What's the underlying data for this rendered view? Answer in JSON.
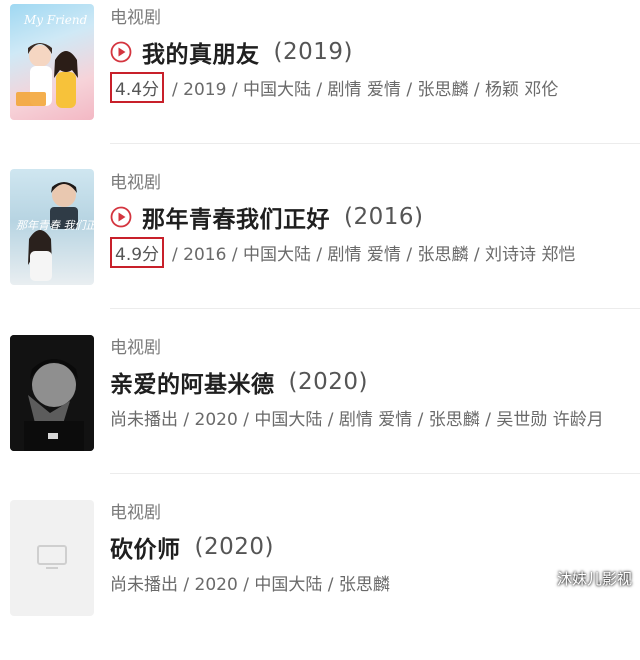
{
  "results": [
    {
      "category": "电视剧",
      "title": "我的真朋友",
      "year": "(2019)",
      "rating": "4.4分",
      "meta": "/ 2019 / 中国大陆 / 剧情 爱情 / 张思麟 / 杨颖 邓伦",
      "poster_text": "My Friend",
      "playable": true
    },
    {
      "category": "电视剧",
      "title": "那年青春我们正好",
      "year": "(2016)",
      "rating": "4.9分",
      "meta": "/ 2016 / 中国大陆 / 剧情 爱情 / 张思麟 / 刘诗诗 郑恺",
      "poster_text": "那年青春 我们正好",
      "playable": true
    },
    {
      "category": "电视剧",
      "title": "亲爱的阿基米德",
      "year": "(2020)",
      "meta": "尚未播出 / 2020 / 中国大陆 / 剧情 爱情 / 张思麟 / 吴世勋 许龄月",
      "playable": false
    },
    {
      "category": "电视剧",
      "title": "砍价师",
      "year": "(2020)",
      "meta": "尚未播出 / 2020 / 中国大陆 / 张思麟",
      "playable": false
    }
  ],
  "colors": {
    "play_icon": "#d4353f",
    "rating_highlight": "#c8202a"
  },
  "icons": {
    "play": "play-circle-icon",
    "placeholder": "tv-placeholder-icon"
  },
  "watermark": "沐妹儿影视"
}
